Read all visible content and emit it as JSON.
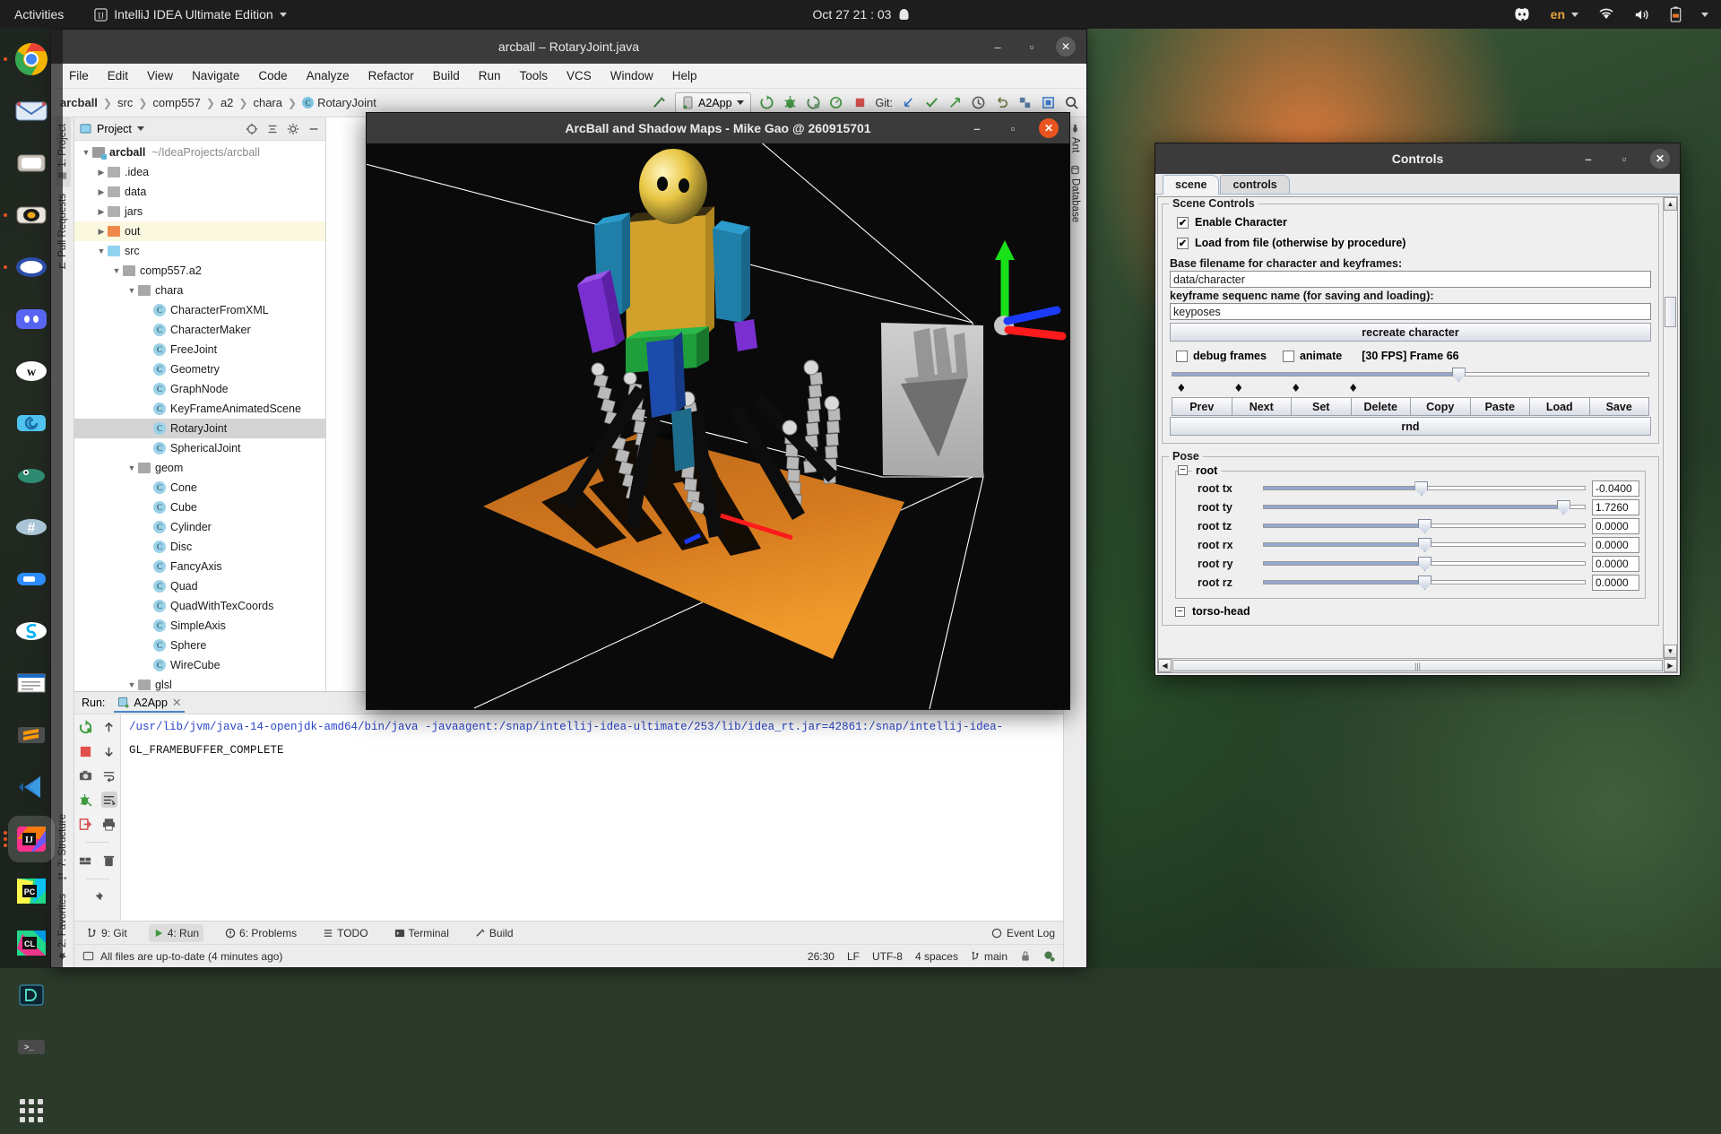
{
  "topbar": {
    "activities": "Activities",
    "app_menu": "IntelliJ IDEA Ultimate Edition",
    "clock": "Oct 27 21 : 03",
    "language": "en",
    "icons": [
      "discord-icon",
      "wifi-icon",
      "volume-icon",
      "battery-icon",
      "system-menu-chevron-icon"
    ]
  },
  "dock": {
    "items": [
      {
        "name": "google-chrome",
        "label": "",
        "running": true
      },
      {
        "name": "thunderbird-mail",
        "label": "",
        "running": false
      },
      {
        "name": "files-nautilus",
        "label": "",
        "running": false
      },
      {
        "name": "rhythmbox",
        "label": "",
        "running": true
      },
      {
        "name": "ubuntu-software",
        "label": "",
        "running": true
      },
      {
        "name": "discord",
        "label": "",
        "running": false
      },
      {
        "name": "wire",
        "label": "",
        "running": false
      },
      {
        "name": "spiral-app",
        "label": "",
        "running": false
      },
      {
        "name": "gimp",
        "label": "",
        "running": false
      },
      {
        "name": "slack",
        "label": "#",
        "running": false
      },
      {
        "name": "zoom",
        "label": "",
        "running": false
      },
      {
        "name": "skype",
        "label": "S",
        "running": false
      },
      {
        "name": "libreoffice-writer",
        "label": "",
        "running": false
      },
      {
        "name": "sublime-text",
        "label": "",
        "running": false
      },
      {
        "name": "visual-studio-code",
        "label": "",
        "running": false
      },
      {
        "name": "intellij-idea",
        "label": "IJ",
        "running": true
      },
      {
        "name": "pycharm",
        "label": "PC",
        "running": false
      },
      {
        "name": "clion",
        "label": "CL",
        "running": false
      },
      {
        "name": "datagrip",
        "label": "D",
        "running": false
      },
      {
        "name": "terminal",
        "label": "",
        "running": false
      },
      {
        "name": "show-applications",
        "label": "",
        "running": false
      }
    ]
  },
  "idea": {
    "title": "arcball – RotaryJoint.java",
    "menu": [
      "File",
      "Edit",
      "View",
      "Navigate",
      "Code",
      "Analyze",
      "Refactor",
      "Build",
      "Run",
      "Tools",
      "VCS",
      "Window",
      "Help"
    ],
    "breadcrumb": [
      "arcball",
      "src",
      "comp557",
      "a2",
      "chara",
      "RotaryJoint"
    ],
    "run_config": "A2App",
    "git_label": "Git:",
    "left_strips": [
      "1: Project",
      "Pull Requests",
      "7: Structure",
      "2: Favorites"
    ],
    "right_strips": [
      "Ant",
      "Database"
    ],
    "project": {
      "header": "Project",
      "tree": [
        {
          "depth": 0,
          "arrow": "v",
          "icon": "module",
          "label": "arcball",
          "bold": true,
          "path": "~/IdeaProjects/arcball",
          "state": "normal"
        },
        {
          "depth": 1,
          "arrow": ">",
          "icon": "folder",
          "label": ".idea",
          "state": "normal"
        },
        {
          "depth": 1,
          "arrow": ">",
          "icon": "folder",
          "label": "data",
          "state": "normal"
        },
        {
          "depth": 1,
          "arrow": ">",
          "icon": "folder",
          "label": "jars",
          "state": "normal"
        },
        {
          "depth": 1,
          "arrow": ">",
          "icon": "folder-out",
          "label": "out",
          "state": "highlight"
        },
        {
          "depth": 1,
          "arrow": "v",
          "icon": "folder-src",
          "label": "src",
          "state": "normal"
        },
        {
          "depth": 2,
          "arrow": "v",
          "icon": "package",
          "label": "comp557.a2",
          "state": "normal"
        },
        {
          "depth": 3,
          "arrow": "v",
          "icon": "package",
          "label": "chara",
          "state": "normal"
        },
        {
          "depth": 4,
          "arrow": "",
          "icon": "class",
          "label": "CharacterFromXML",
          "state": "normal"
        },
        {
          "depth": 4,
          "arrow": "",
          "icon": "class",
          "label": "CharacterMaker",
          "state": "normal"
        },
        {
          "depth": 4,
          "arrow": "",
          "icon": "class",
          "label": "FreeJoint",
          "state": "normal"
        },
        {
          "depth": 4,
          "arrow": "",
          "icon": "class",
          "label": "Geometry",
          "state": "normal"
        },
        {
          "depth": 4,
          "arrow": "",
          "icon": "class",
          "label": "GraphNode",
          "state": "normal"
        },
        {
          "depth": 4,
          "arrow": "",
          "icon": "class",
          "label": "KeyFrameAnimatedScene",
          "state": "normal"
        },
        {
          "depth": 4,
          "arrow": "",
          "icon": "class",
          "label": "RotaryJoint",
          "state": "selected"
        },
        {
          "depth": 4,
          "arrow": "",
          "icon": "class",
          "label": "SphericalJoint",
          "state": "normal"
        },
        {
          "depth": 3,
          "arrow": "v",
          "icon": "package",
          "label": "geom",
          "state": "normal"
        },
        {
          "depth": 4,
          "arrow": "",
          "icon": "class",
          "label": "Cone",
          "state": "normal"
        },
        {
          "depth": 4,
          "arrow": "",
          "icon": "class",
          "label": "Cube",
          "state": "normal"
        },
        {
          "depth": 4,
          "arrow": "",
          "icon": "class",
          "label": "Cylinder",
          "state": "normal"
        },
        {
          "depth": 4,
          "arrow": "",
          "icon": "class",
          "label": "Disc",
          "state": "normal"
        },
        {
          "depth": 4,
          "arrow": "",
          "icon": "class",
          "label": "FancyAxis",
          "state": "normal"
        },
        {
          "depth": 4,
          "arrow": "",
          "icon": "class",
          "label": "Quad",
          "state": "normal"
        },
        {
          "depth": 4,
          "arrow": "",
          "icon": "class",
          "label": "QuadWithTexCoords",
          "state": "normal"
        },
        {
          "depth": 4,
          "arrow": "",
          "icon": "class",
          "label": "SimpleAxis",
          "state": "normal"
        },
        {
          "depth": 4,
          "arrow": "",
          "icon": "class",
          "label": "Sphere",
          "state": "normal"
        },
        {
          "depth": 4,
          "arrow": "",
          "icon": "class",
          "label": "WireCube",
          "state": "normal"
        },
        {
          "depth": 3,
          "arrow": "v",
          "icon": "package",
          "label": "glsl",
          "state": "normal"
        }
      ]
    },
    "run": {
      "label": "Run:",
      "tab": "A2App",
      "console_cmd": "/usr/lib/jvm/java-14-openjdk-amd64/bin/java -javaagent:/snap/intellij-idea-ultimate/253/lib/idea_rt.jar=42861:/snap/intellij-idea-",
      "console_out": "GL_FRAMEBUFFER_COMPLETE"
    },
    "toolwindow_bar": [
      {
        "label": "9: Git",
        "icon": "branch-icon",
        "selected": false
      },
      {
        "label": "4: Run",
        "icon": "run-icon",
        "selected": true
      },
      {
        "label": "6: Problems",
        "icon": "problems-icon",
        "selected": false
      },
      {
        "label": "TODO",
        "icon": "todo-icon",
        "selected": false
      },
      {
        "label": "Terminal",
        "icon": "terminal-icon",
        "selected": false
      },
      {
        "label": "Build",
        "icon": "build-icon",
        "selected": false
      }
    ],
    "event_log": "Event Log",
    "status": {
      "message": "All files are up-to-date (4 minutes ago)",
      "caret": "26:30",
      "line_sep": "LF",
      "encoding": "UTF-8",
      "indent": "4 spaces",
      "branch": "main"
    }
  },
  "gl_window": {
    "title": "ArcBall and Shadow Maps - Mike Gao @ 260915701",
    "scene": {
      "ground_color": "#d4791f",
      "background": "#0a0a0a",
      "axis_colors": {
        "x": "#ff1b1b",
        "y": "#19e019",
        "z": "#1b3bff"
      },
      "shadow_map_label": "shadow-map-preview"
    }
  },
  "controls_window": {
    "title": "Controls",
    "tabs": [
      {
        "label": "scene",
        "selected": true
      },
      {
        "label": "controls",
        "selected": false
      }
    ],
    "scene_controls": {
      "group_title": "Scene Controls",
      "enable_character": {
        "label": "Enable Character",
        "checked": true
      },
      "load_from_file": {
        "label": "Load from file (otherwise by procedure)",
        "checked": true
      },
      "base_filename_label": "Base filename for character and keyframes:",
      "base_filename_value": "data/character",
      "keyframe_name_label": "keyframe sequenc name (for saving and loading):",
      "keyframe_name_value": "keyposes",
      "recreate_button": "recreate character",
      "debug_frames": {
        "label": "debug frames",
        "checked": false
      },
      "animate": {
        "label": "animate",
        "checked": false
      },
      "fps_frame": "[30 FPS] Frame 66",
      "timeline_percent": 60,
      "keyframe_markers": [
        1,
        13,
        25,
        37
      ],
      "buttons": [
        "Prev",
        "Next",
        "Set",
        "Delete",
        "Copy",
        "Paste",
        "Load",
        "Save"
      ],
      "rnd_button": "rnd"
    },
    "pose": {
      "group_title": "Pose",
      "root_group": "root",
      "sliders": [
        {
          "name": "root tx",
          "value": "-0.0400",
          "percent": 49
        },
        {
          "name": "root ty",
          "value": "1.7260",
          "percent": 93
        },
        {
          "name": "root tz",
          "value": "0.0000",
          "percent": 50
        },
        {
          "name": "root rx",
          "value": "0.0000",
          "percent": 50
        },
        {
          "name": "root ry",
          "value": "0.0000",
          "percent": 50
        },
        {
          "name": "root rz",
          "value": "0.0000",
          "percent": 50
        }
      ],
      "next_group": "torso-head"
    }
  }
}
